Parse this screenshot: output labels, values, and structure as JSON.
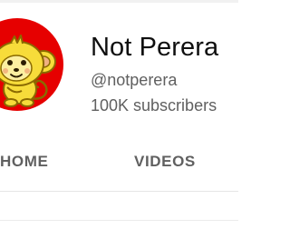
{
  "channel": {
    "name": "Not Perera",
    "handle": "@notperera",
    "subscribers": "100K subscribers",
    "avatar_icon": "yellow-monkey-cartoon-icon",
    "avatar_background": "#e60000"
  },
  "tabs": [
    {
      "label": "HOME"
    },
    {
      "label": "VIDEOS"
    }
  ],
  "colors": {
    "primary_text": "#0f0f0f",
    "secondary_text": "#606060",
    "divider": "#e5e5e5"
  }
}
